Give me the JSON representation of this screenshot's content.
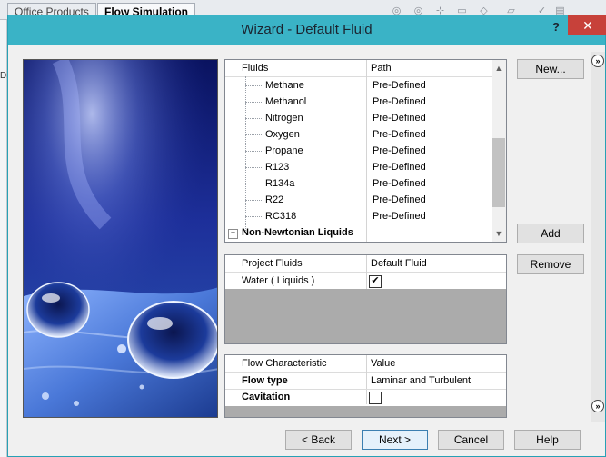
{
  "background": {
    "tabs": [
      "Office Products",
      "Flow Simulation"
    ],
    "left_fragment": "Di"
  },
  "dialog": {
    "title": "Wizard - Default Fluid",
    "help_label": "?",
    "close_label": "✕"
  },
  "fluids_table": {
    "headers": [
      "Fluids",
      "Path"
    ],
    "rows": [
      {
        "name": "Methane",
        "path": "Pre-Defined"
      },
      {
        "name": "Methanol",
        "path": "Pre-Defined"
      },
      {
        "name": "Nitrogen",
        "path": "Pre-Defined"
      },
      {
        "name": "Oxygen",
        "path": "Pre-Defined"
      },
      {
        "name": "Propane",
        "path": "Pre-Defined"
      },
      {
        "name": "R123",
        "path": "Pre-Defined"
      },
      {
        "name": "R134a",
        "path": "Pre-Defined"
      },
      {
        "name": "R22",
        "path": "Pre-Defined"
      },
      {
        "name": "RC318",
        "path": "Pre-Defined"
      }
    ],
    "group": "Non-Newtonian Liquids",
    "group_expander": "+"
  },
  "project_table": {
    "headers": [
      "Project Fluids",
      "Default Fluid"
    ],
    "rows": [
      {
        "name": "Water ( Liquids )",
        "default": true
      }
    ]
  },
  "flow_table": {
    "headers": [
      "Flow Characteristic",
      "Value"
    ],
    "rows": [
      {
        "name": "Flow type",
        "value": "Laminar and Turbulent"
      },
      {
        "name": "Cavitation",
        "value": ""
      }
    ],
    "cavitation_checked": false
  },
  "buttons": {
    "new": "New...",
    "add": "Add",
    "remove": "Remove",
    "back": "< Back",
    "next": "Next >",
    "cancel": "Cancel",
    "help": "Help"
  },
  "icons": {
    "expand_top": "»",
    "expand_bottom": "»",
    "scroll_up": "▲",
    "scroll_down": "▼",
    "check": "✔"
  },
  "colors": {
    "titlebar": "#3ab3c6",
    "close": "#c7413a",
    "image_blue": "#2a4fb0"
  }
}
